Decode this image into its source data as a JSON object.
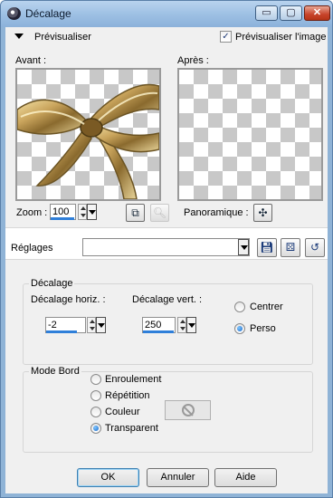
{
  "window": {
    "title": "Décalage",
    "controls": {
      "minimize": "▭",
      "maximize": "▢",
      "close": "✕"
    }
  },
  "preview_bar": {
    "label": "Prévisualiser",
    "checkbox_label": "Prévisualiser l'image",
    "checkbox_checked": true
  },
  "preview": {
    "before_label": "Avant :",
    "after_label": "Après :"
  },
  "zoom": {
    "label": "Zoom :",
    "value": "100"
  },
  "panoramique": {
    "label": "Panoramique :"
  },
  "reglages": {
    "label": "Réglages",
    "value": ""
  },
  "decalage": {
    "title": "Décalage",
    "horiz_label": "Décalage horiz. :",
    "horiz_value": "-2",
    "vert_label": "Décalage vert. :",
    "vert_value": "250",
    "options": [
      {
        "label": "Centrer",
        "selected": false
      },
      {
        "label": "Perso",
        "selected": true
      }
    ]
  },
  "mode_bord": {
    "title": "Mode Bord",
    "options": [
      {
        "label": "Enroulement",
        "selected": false
      },
      {
        "label": "Répétition",
        "selected": false
      },
      {
        "label": "Couleur",
        "selected": false
      },
      {
        "label": "Transparent",
        "selected": true
      }
    ]
  },
  "buttons": {
    "ok": "OK",
    "cancel": "Annuler",
    "help": "Aide"
  },
  "icons": {
    "app": "app-icon",
    "collapse": "triangle-down-icon",
    "fit": "fit-window-icon",
    "zoom_tool": "magnifier-icon",
    "pan": "move-cross-icon",
    "save": "floppy-disk-icon",
    "randomize": "dice-icon",
    "reset": "reset-arrow-icon",
    "no_color": "no-color-icon"
  },
  "colors": {
    "accent": "#2f7fd9",
    "title_bar": "#9cbfe3",
    "close_button": "#c7432a"
  }
}
